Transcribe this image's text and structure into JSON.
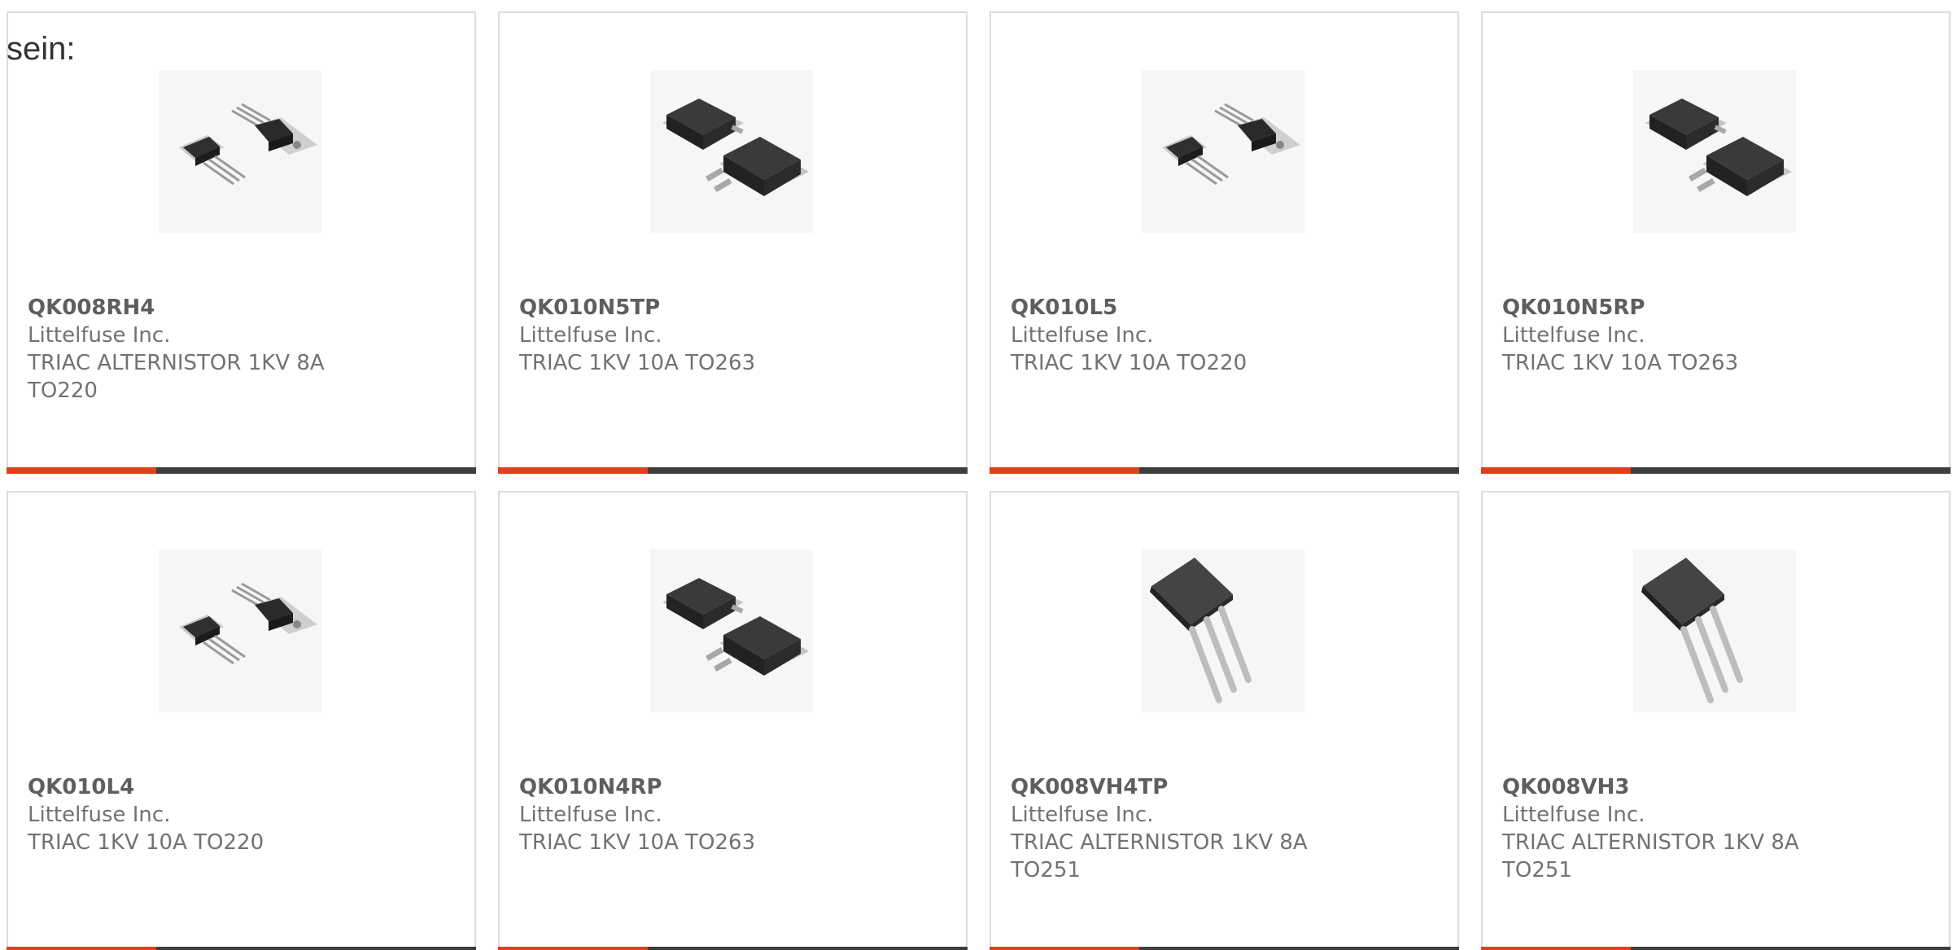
{
  "intro_text": "sein:",
  "colors": {
    "accent": "#e2401c",
    "bar_dark": "#3e3e3e",
    "card_border": "#dcdcdc",
    "text": "#6b6b6b"
  },
  "products": [
    {
      "part_number": "QK008RH4",
      "manufacturer": "Littelfuse Inc.",
      "description": "TRIAC ALTERNISTOR 1KV 8A TO220",
      "image": "to220-package-icon"
    },
    {
      "part_number": "QK010N5TP",
      "manufacturer": "Littelfuse Inc.",
      "description": "TRIAC 1KV 10A TO263",
      "image": "to263-package-icon"
    },
    {
      "part_number": "QK010L5",
      "manufacturer": "Littelfuse Inc.",
      "description": "TRIAC 1KV 10A TO220",
      "image": "to220-package-icon"
    },
    {
      "part_number": "QK010N5RP",
      "manufacturer": "Littelfuse Inc.",
      "description": "TRIAC 1KV 10A TO263",
      "image": "to263-package-icon"
    },
    {
      "part_number": "QK010L4",
      "manufacturer": "Littelfuse Inc.",
      "description": "TRIAC 1KV 10A TO220",
      "image": "to220-package-icon"
    },
    {
      "part_number": "QK010N4RP",
      "manufacturer": "Littelfuse Inc.",
      "description": "TRIAC 1KV 10A TO263",
      "image": "to263-package-icon"
    },
    {
      "part_number": "QK008VH4TP",
      "manufacturer": "Littelfuse Inc.",
      "description": "TRIAC ALTERNISTOR 1KV 8A TO251",
      "image": "to251-package-icon"
    },
    {
      "part_number": "QK008VH3",
      "manufacturer": "Littelfuse Inc.",
      "description": "TRIAC ALTERNISTOR 1KV 8A TO251",
      "image": "to251-package-icon"
    }
  ]
}
